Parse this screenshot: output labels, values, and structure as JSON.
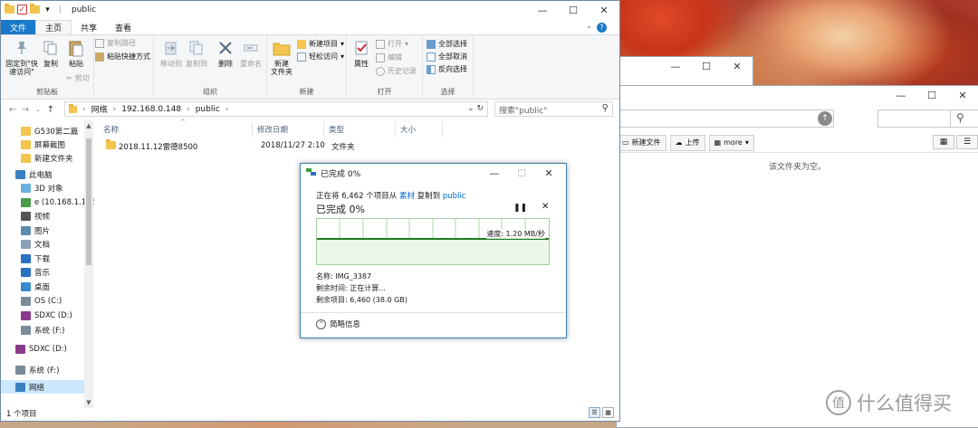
{
  "explorer": {
    "title": "public",
    "tabs": [
      {
        "label": "文件"
      },
      {
        "label": "主页"
      },
      {
        "label": "共享"
      },
      {
        "label": "查看"
      }
    ],
    "ribbon": {
      "clipboard": {
        "label": "剪贴板",
        "pin": "固定到\"快速访问\"",
        "copy": "复制",
        "paste": "粘贴",
        "copy_path": "复制路径",
        "paste_shortcut": "粘贴快捷方式",
        "cut": "剪切"
      },
      "organize": {
        "label": "组织",
        "move_to": "移动到",
        "copy_to": "复制到",
        "delete": "删除",
        "rename": "重命名"
      },
      "new": {
        "label": "新建",
        "new_folder": "新建\n文件夹",
        "new_item": "新建项目",
        "easy_access": "轻松访问"
      },
      "open": {
        "label": "打开",
        "properties": "属性",
        "open": "打开",
        "edit": "编辑",
        "history": "历史记录"
      },
      "select": {
        "label": "选择",
        "select_all": "全部选择",
        "select_none": "全部取消",
        "invert": "反向选择"
      }
    },
    "address": {
      "segments": [
        "网络",
        "192.168.0.148",
        "public"
      ]
    },
    "search_placeholder": "搜索\"public\"",
    "sidebar": [
      {
        "label": "G530第二篇",
        "icon": "folder-icon"
      },
      {
        "label": "屏幕截图",
        "icon": "folder-icon"
      },
      {
        "label": "新建文件夹",
        "icon": "folder-icon"
      },
      {
        "label": "此电脑",
        "icon": "computer-icon"
      },
      {
        "label": "3D 对象",
        "icon": "3d-objects-icon"
      },
      {
        "label": "e (10.168.1.166",
        "icon": "network-drive-icon"
      },
      {
        "label": "视频",
        "icon": "video-icon"
      },
      {
        "label": "图片",
        "icon": "pictures-icon"
      },
      {
        "label": "文档",
        "icon": "documents-icon"
      },
      {
        "label": "下载",
        "icon": "download-icon"
      },
      {
        "label": "音乐",
        "icon": "music-icon"
      },
      {
        "label": "桌面",
        "icon": "desktop-icon"
      },
      {
        "label": "OS (C:)",
        "icon": "drive-icon"
      },
      {
        "label": "SDXC (D:)",
        "icon": "sd-card-icon"
      },
      {
        "label": "系统 (F:)",
        "icon": "drive-icon"
      },
      {
        "label": "SDXC (D:)",
        "icon": "sd-card-icon"
      },
      {
        "label": "系统 (F:)",
        "icon": "drive-icon"
      },
      {
        "label": "网络",
        "icon": "network-icon"
      }
    ],
    "columns": [
      "名称",
      "修改日期",
      "类型",
      "大小"
    ],
    "files": [
      {
        "name": "2018.11.12雷德8500",
        "date": "2018/11/27 2:10",
        "type": "文件夹",
        "size": ""
      }
    ],
    "status": "1 个项目"
  },
  "copy_dialog": {
    "title": "已完成 0%",
    "line_prefix": "正在将 6,462 个项目从",
    "source": "素材",
    "line_mid": "复制到",
    "dest": "public",
    "progress_text": "已完成 0%",
    "progress_percent": 0,
    "speed": "速度: 1.20 MB/秒",
    "name_line": "名称: IMG_3387",
    "time_line": "剩余时间: 正在计算...",
    "items_line": "剩余项目: 6,460 (38.0 GB)",
    "less_info": "简略信息"
  },
  "back_window": {
    "new_folder": "新建文件",
    "upload": "上传",
    "more": "more",
    "empty_text": "该文件夹为空。"
  },
  "watermark": {
    "text": "什么值得买"
  }
}
